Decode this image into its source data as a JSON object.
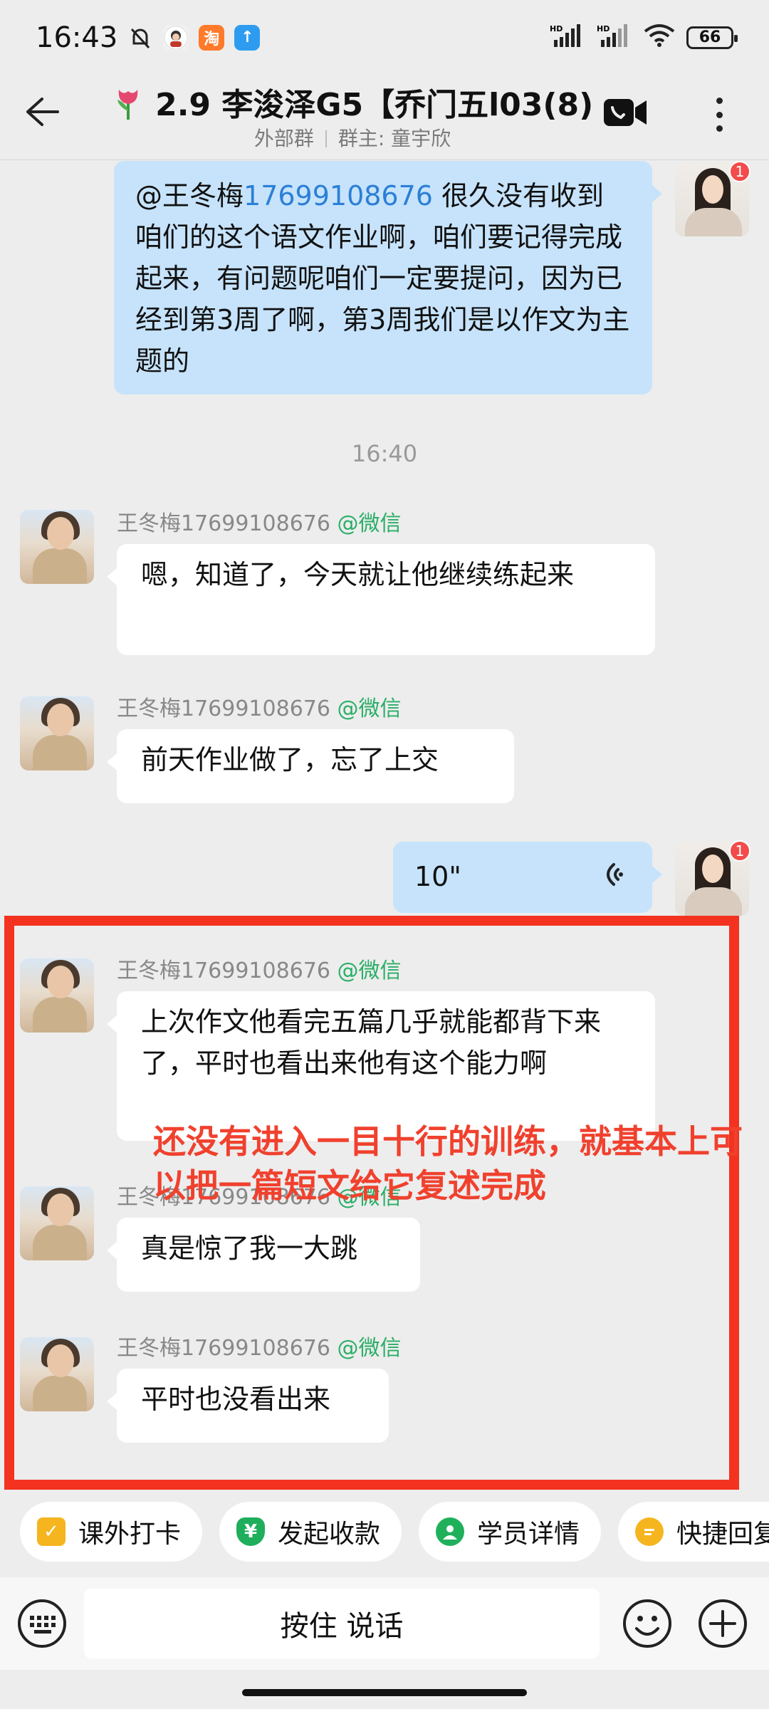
{
  "status_bar": {
    "time": "16:43",
    "battery": "66",
    "network_labels": [
      "HD",
      "HD"
    ]
  },
  "header": {
    "title": "2.9 李浚泽G5【乔门五l03",
    "member_count": "(8)",
    "subtitle_type": "外部群",
    "subtitle_owner": "群主: 童宇欣",
    "icons": [
      "back-arrow-icon",
      "video-call-icon",
      "more-icon"
    ]
  },
  "messages": [
    {
      "direction": "outgoing",
      "mention": "@王冬梅",
      "mention_number": "17699108676",
      "text": "  很久没有收到咱们的这个语文作业啊，咱们要记得完成起来，有问题呢咱们一定要提问，因为已经到第3周了啊，第3周我们是以作文为主题的",
      "badge": "1"
    },
    {
      "type": "timestamp",
      "text": "16:40"
    },
    {
      "direction": "incoming",
      "sender": "王冬梅17699108676",
      "source": "@微信",
      "text": "嗯，知道了，今天就让他继续练起来"
    },
    {
      "direction": "incoming",
      "sender": "王冬梅17699108676",
      "source": "@微信",
      "text": "前天作业做了，忘了上交"
    },
    {
      "direction": "outgoing",
      "type": "voice",
      "duration": "10\"",
      "badge": "1"
    },
    {
      "direction": "incoming",
      "sender": "王冬梅17699108676",
      "source": "@微信",
      "text": "上次作文他看完五篇几乎就能都背下来了，平时也看出来他有这个能力啊"
    },
    {
      "direction": "incoming",
      "sender": "王冬梅17699108676",
      "source": "@微信",
      "text": "真是惊了我一大跳"
    },
    {
      "direction": "incoming",
      "sender": "王冬梅17699108676",
      "source": "@微信",
      "text": "平时也没看出来"
    }
  ],
  "annotation": {
    "text": "还没有进入一目十行的训练，就基本上可以把一篇短文给它复述完成",
    "color": "#f0412e"
  },
  "quick_actions": [
    {
      "label": "课外打卡",
      "icon": "calendar-check-icon"
    },
    {
      "label": "发起收款",
      "icon": "payment-shield-icon"
    },
    {
      "label": "学员详情",
      "icon": "student-detail-icon"
    },
    {
      "label": "快捷回复",
      "icon": "quick-reply-icon"
    }
  ],
  "input_bar": {
    "hold_to_talk": "按住 说话",
    "icons": [
      "keyboard-icon",
      "emoji-icon",
      "plus-icon"
    ]
  },
  "colors": {
    "background": "#ededed",
    "outgoing_bubble": "#c6e3fb",
    "incoming_bubble": "#ffffff",
    "wechat_green": "#2aae67",
    "mention_blue": "#2b7fd6",
    "highlight_red": "#f3321f",
    "badge_red": "#f24b4b"
  }
}
